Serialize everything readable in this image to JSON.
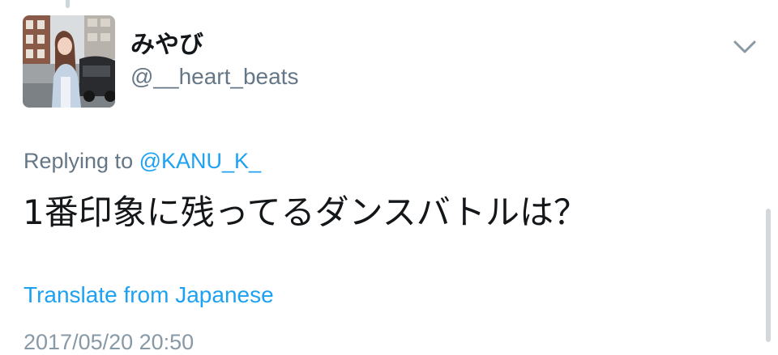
{
  "user": {
    "display_name": "みやび",
    "handle": "@__heart_beats"
  },
  "reply": {
    "prefix": "Replying to",
    "target": "@KANU_K_"
  },
  "tweet": {
    "text": "1番印象に残ってるダンスバトルは？",
    "translate_label": "Translate from Japanese",
    "timestamp": "2017/05/20 20:50"
  },
  "icons": {
    "menu": "chevron-down-icon"
  },
  "colors": {
    "link": "#1da1f2",
    "secondary_text": "#657786",
    "primary_text": "#14171a"
  }
}
